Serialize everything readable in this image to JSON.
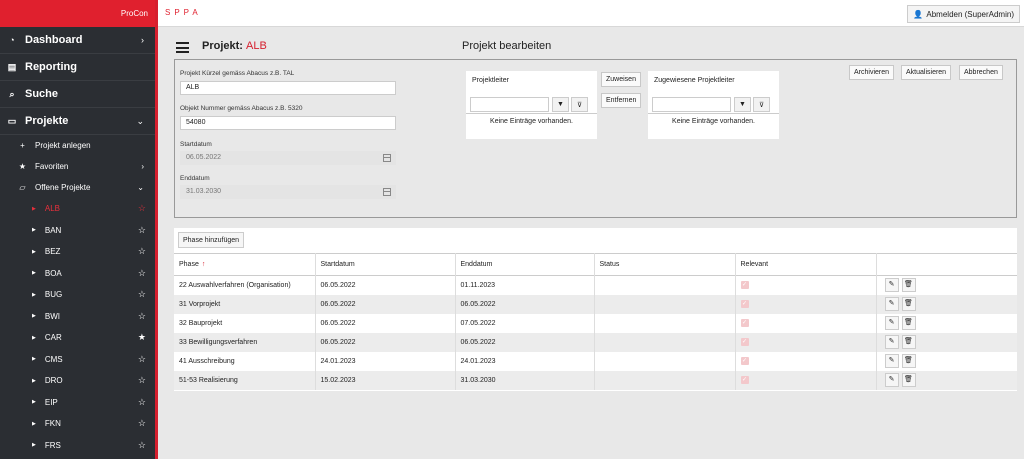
{
  "sidebar": {
    "brand": "ProCon",
    "nav": [
      {
        "label": "Dashboard",
        "icon": "dashboard-icon"
      },
      {
        "label": "Reporting",
        "icon": "document-icon"
      },
      {
        "label": "Suche",
        "icon": "search-icon"
      },
      {
        "label": "Projekte",
        "icon": "folder-icon"
      }
    ],
    "sub": [
      {
        "label": "Projekt anlegen",
        "icon": "plus-icon"
      },
      {
        "label": "Favoriten",
        "icon": "star-icon"
      },
      {
        "label": "Offene Projekte",
        "icon": "folder-open-icon"
      }
    ],
    "projects": [
      {
        "label": "ALB",
        "active": true,
        "starred": false
      },
      {
        "label": "BAN",
        "starred": false
      },
      {
        "label": "BEZ",
        "starred": false
      },
      {
        "label": "BOA",
        "starred": false
      },
      {
        "label": "BUG",
        "starred": false
      },
      {
        "label": "BWI",
        "starred": false
      },
      {
        "label": "CAR",
        "starred": true
      },
      {
        "label": "CMS",
        "starred": false
      },
      {
        "label": "DRO",
        "starred": false
      },
      {
        "label": "EIP",
        "starred": false
      },
      {
        "label": "FKN",
        "starred": false
      },
      {
        "label": "FRS",
        "starred": false
      }
    ]
  },
  "topbar": {
    "logo": "SPPA",
    "logout": "Abmelden (SuperAdmin)"
  },
  "header": {
    "title_prefix": "Projekt:",
    "title_code": "ALB",
    "heading": "Projekt bearbeiten"
  },
  "form": {
    "kurzel_label": "Projekt Kürzel gemäss Abacus z.B. TAL",
    "kurzel_value": "ALB",
    "nummer_label": "Objekt Nummer gemäss Abacus z.B. 5320",
    "nummer_value": "54080",
    "start_label": "Startdatum",
    "start_value": "06.05.2022",
    "end_label": "Enddatum",
    "end_value": "31.03.2030"
  },
  "picklist": {
    "left_title": "Projektleiter",
    "right_title": "Zugewiesene Projektleiter",
    "empty": "Keine Einträge vorhanden.",
    "assign": "Zuweisen",
    "remove": "Entfernen"
  },
  "actions": {
    "archive": "Archivieren",
    "refresh": "Aktualisieren",
    "cancel": "Abbrechen"
  },
  "phases": {
    "add_button": "Phase hinzufügen",
    "columns": [
      "Phase",
      "Startdatum",
      "Enddatum",
      "Status",
      "Relevant"
    ],
    "rows": [
      {
        "phase": "22 Auswahlverfahren (Organisation)",
        "start": "06.05.2022",
        "end": "01.11.2023",
        "status": ""
      },
      {
        "phase": "31 Vorprojekt",
        "start": "06.05.2022",
        "end": "06.05.2022",
        "status": ""
      },
      {
        "phase": "32 Bauprojekt",
        "start": "06.05.2022",
        "end": "07.05.2022",
        "status": ""
      },
      {
        "phase": "33 Bewilligungsverfahren",
        "start": "06.05.2022",
        "end": "06.05.2022",
        "status": ""
      },
      {
        "phase": "41 Ausschreibung",
        "start": "24.01.2023",
        "end": "24.01.2023",
        "status": ""
      },
      {
        "phase": "51-53 Realisierung",
        "start": "15.02.2023",
        "end": "31.03.2030",
        "status": ""
      }
    ]
  },
  "colors": {
    "accent": "#e0202e",
    "sidebar_bg": "#2b2e33"
  }
}
